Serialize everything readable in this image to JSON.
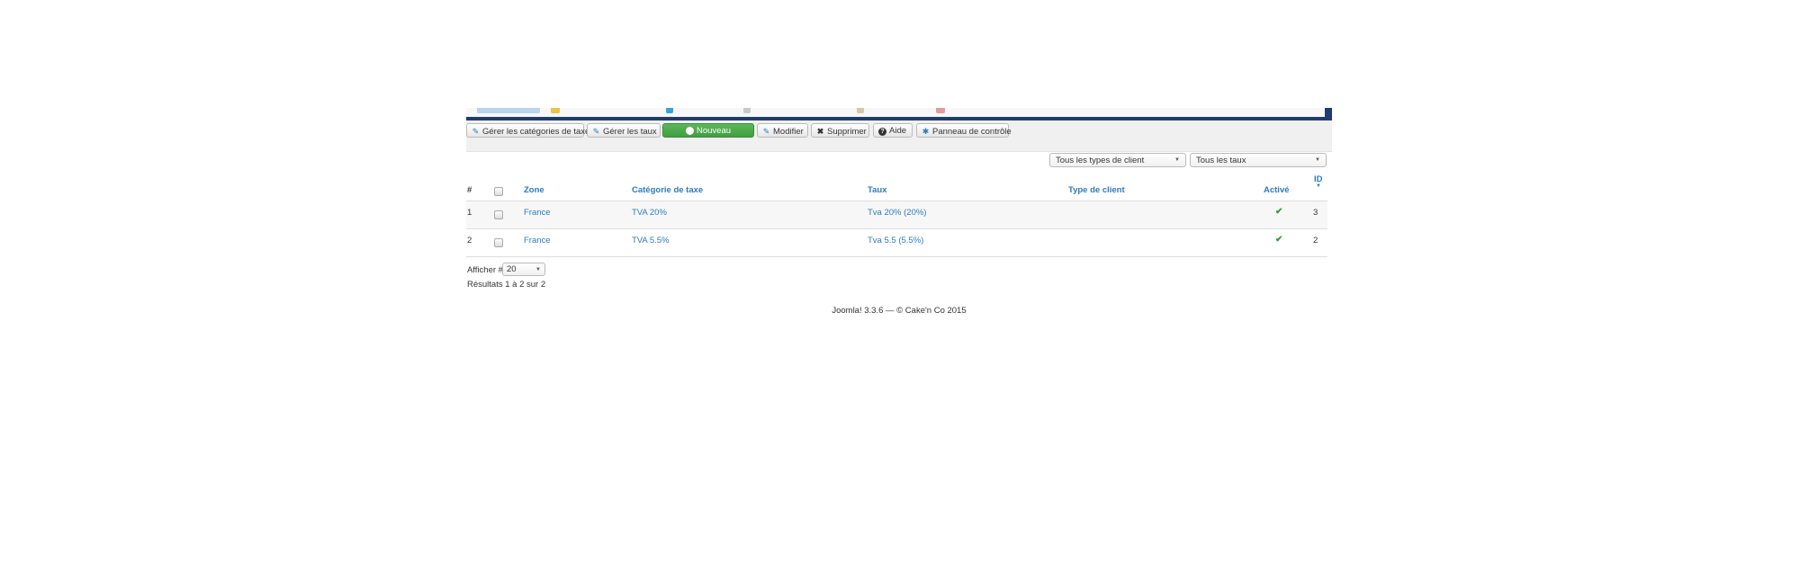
{
  "toolbar": {
    "manage_tax_categories": "Gérer les catégories de taxe",
    "manage_rates": "Gérer les taux",
    "new": "Nouveau",
    "edit": "Modifier",
    "delete": "Supprimer",
    "help": "Aide",
    "control_panel": "Panneau de contrôle"
  },
  "filters": {
    "client_type": "Tous les types de client",
    "rates": "Tous les taux"
  },
  "table": {
    "headers": {
      "num": "#",
      "zone": "Zone",
      "tax_category": "Catégorie de taxe",
      "rate": "Taux",
      "client_type": "Type de client",
      "active": "Activé",
      "id": "ID"
    },
    "rows": [
      {
        "num": "1",
        "zone": "France",
        "tax_category": "TVA 20%",
        "rate": "Tva 20% (20%)",
        "client_type": "",
        "active": true,
        "id": "3"
      },
      {
        "num": "2",
        "zone": "France",
        "tax_category": "TVA 5.5%",
        "rate": "Tva 5.5 (5.5%)",
        "client_type": "",
        "active": true,
        "id": "2"
      }
    ]
  },
  "pagination": {
    "show_label": "Afficher #",
    "limit": "20",
    "results": "Résultats 1 à 2 sur 2"
  },
  "footer": {
    "text": "Joomla! 3.3.6  —  © Cake'n Co 2015"
  },
  "colors": {
    "accent": "#2b7bc0",
    "header_bar": "#1f3c6e",
    "new_button": "#4cae4c",
    "check": "#3a9a3a"
  }
}
